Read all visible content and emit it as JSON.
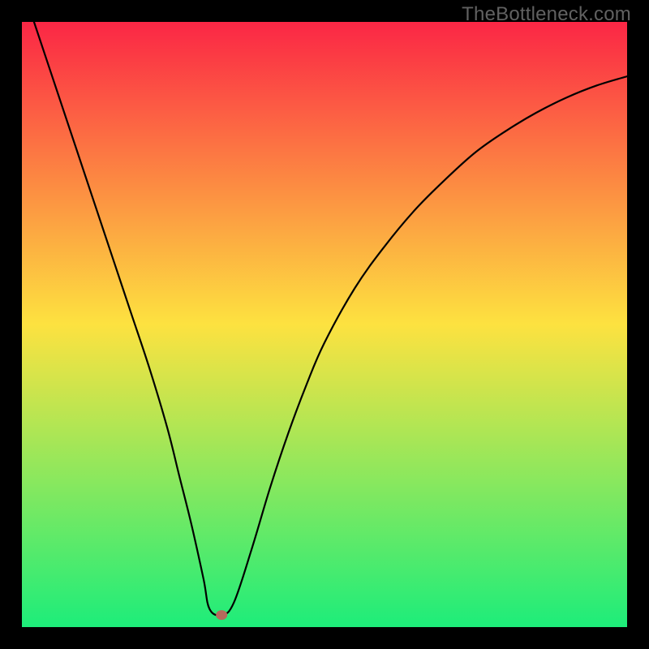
{
  "watermark": "TheBottleneck.com",
  "colors": {
    "gradient_top": "#fb2645",
    "gradient_mid": "#fde240",
    "gradient_bottom": "#1ded7a",
    "curve": "#000000",
    "marker": "#b6695c",
    "frame": "#000000",
    "watermark_text": "#616161"
  },
  "chart_data": {
    "type": "line",
    "title": "",
    "xlabel": "",
    "ylabel": "",
    "xlim": [
      0,
      100
    ],
    "ylim": [
      0,
      100
    ],
    "grid": false,
    "legend": false,
    "optimum": {
      "x": 33.0,
      "y": 2.0
    },
    "series": [
      {
        "name": "bottleneck-curve",
        "x": [
          0,
          3,
          6,
          9,
          12,
          15,
          18,
          21,
          24,
          26,
          28,
          30,
          31,
          33,
          35,
          38,
          41,
          44,
          47,
          50,
          55,
          60,
          65,
          70,
          75,
          80,
          85,
          90,
          95,
          100
        ],
        "values": [
          106,
          97,
          88,
          79,
          70,
          61,
          52,
          43,
          33,
          25,
          17,
          8,
          3,
          2,
          4,
          13,
          23,
          32,
          40,
          47,
          56,
          63,
          69,
          74,
          78.5,
          82,
          85,
          87.5,
          89.5,
          91
        ]
      }
    ]
  }
}
